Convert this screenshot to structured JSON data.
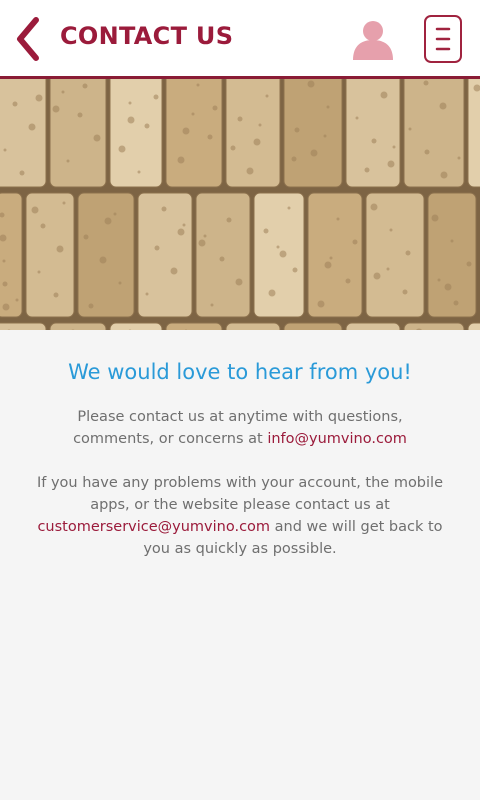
{
  "header": {
    "title": "CONTACT US",
    "back_icon": "chevron-left-icon",
    "user_icon": "user-icon",
    "menu_icon": "menu-icon"
  },
  "hero": {
    "image": "wine-corks-photo"
  },
  "content": {
    "headline": "We would love to hear from you!",
    "para1_text": "Please contact us at anytime with questions, comments, or concerns at ",
    "para1_email": "info@yumvino.com",
    "para2_text_1": "If you have any problems with your account, the mobile apps, or the website please contact us at ",
    "para2_email": "customerservice@yumvino.com",
    "para2_text_2": " and we will get back to you as quickly as possible."
  },
  "colors": {
    "brand": "#9b1b3b",
    "headline": "#2a9ad8",
    "text": "#6f6f6f",
    "background": "#f5f5f5",
    "user_icon": "#e6a0ac"
  }
}
